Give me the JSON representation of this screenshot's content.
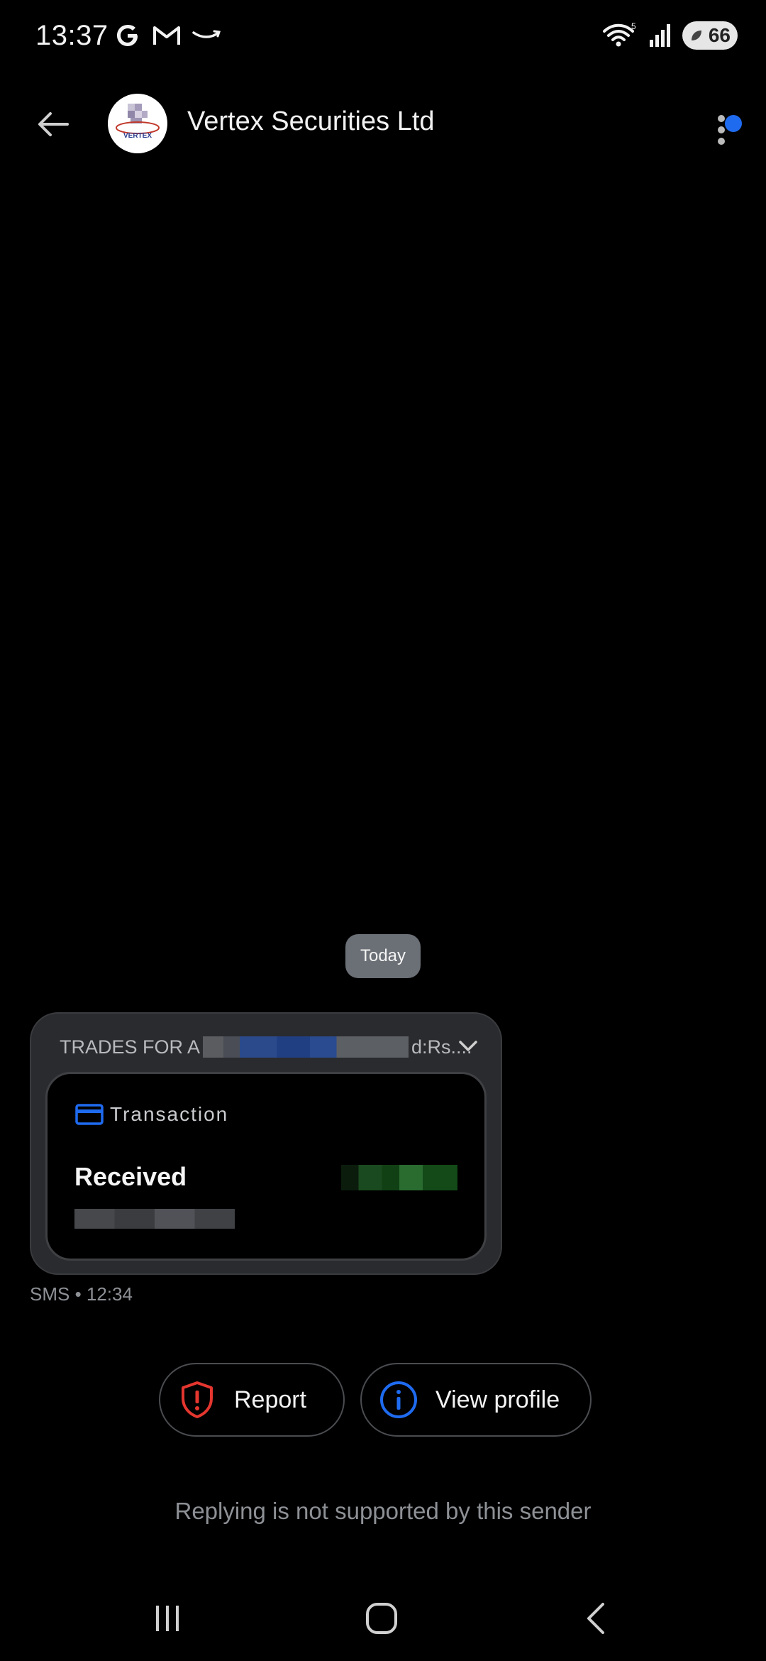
{
  "status_bar": {
    "time": "13:37",
    "notification_icons": [
      "google-icon",
      "gmail-icon",
      "amazon-icon"
    ],
    "wifi_badge": "5",
    "battery": "66"
  },
  "header": {
    "title": "Vertex Securities Ltd",
    "avatar_text": "VERTEX"
  },
  "conversation": {
    "date_chip": "Today",
    "message": {
      "preview_prefix": "TRADES FOR A",
      "preview_suffix": "d:Rs....",
      "card_tag": "Transaction",
      "card_title": "Received"
    },
    "meta": "SMS • 12:34"
  },
  "actions": {
    "report_label": "Report",
    "view_profile_label": "View profile"
  },
  "footer": {
    "reply_note": "Replying is not supported by this sender"
  },
  "colors": {
    "accent_blue": "#1f6bf0",
    "report_red": "#e5362f",
    "bubble_bg": "#2a2b2e"
  }
}
